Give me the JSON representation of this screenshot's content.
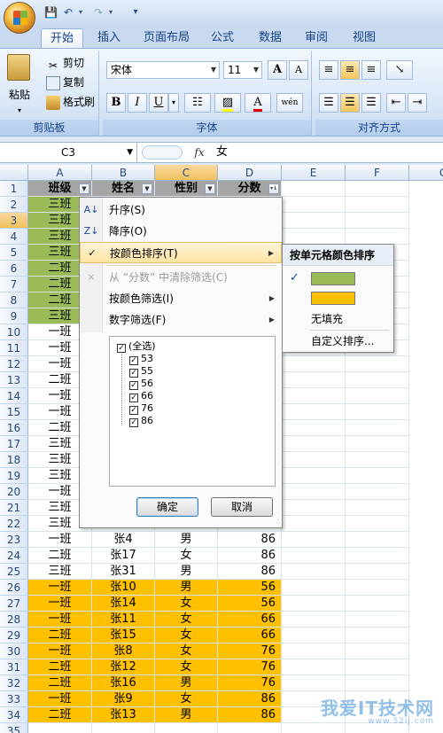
{
  "ribbon_tabs": [
    "开始",
    "插入",
    "页面布局",
    "公式",
    "数据",
    "审阅",
    "视图"
  ],
  "clipboard": {
    "paste": "粘贴",
    "cut": "剪切",
    "copy": "复制",
    "format_painter": "格式刷",
    "group": "剪贴板"
  },
  "font": {
    "name": "宋体",
    "size": "11",
    "group": "字体",
    "bold": "B",
    "italic": "I",
    "underline": "U",
    "grow": "A",
    "shrink": "A",
    "wen": "wén"
  },
  "alignment": {
    "group": "对齐方式"
  },
  "formula_bar": {
    "name_box": "C3",
    "fx": "fx",
    "content": "女"
  },
  "columns": [
    "A",
    "B",
    "C",
    "D",
    "E",
    "F",
    "G"
  ],
  "headers": {
    "a": "班级",
    "b": "姓名",
    "c": "性别",
    "d": "分数"
  },
  "rows": [
    {
      "n": "1"
    },
    {
      "n": "2",
      "a": "三班"
    },
    {
      "n": "3",
      "a": "三班"
    },
    {
      "n": "4",
      "a": "三班"
    },
    {
      "n": "5",
      "a": "三班"
    },
    {
      "n": "6",
      "a": "二班"
    },
    {
      "n": "7",
      "a": "二班"
    },
    {
      "n": "8",
      "a": "二班"
    },
    {
      "n": "9",
      "a": "三班"
    },
    {
      "n": "10",
      "a": "一班"
    },
    {
      "n": "11",
      "a": "一班"
    },
    {
      "n": "12",
      "a": "一班"
    },
    {
      "n": "13",
      "a": "二班"
    },
    {
      "n": "14",
      "a": "一班"
    },
    {
      "n": "15",
      "a": "一班"
    },
    {
      "n": "16",
      "a": "二班"
    },
    {
      "n": "17",
      "a": "三班"
    },
    {
      "n": "18",
      "a": "三班"
    },
    {
      "n": "19",
      "a": "三班"
    },
    {
      "n": "20",
      "a": "一班"
    },
    {
      "n": "21",
      "a": "三班"
    },
    {
      "n": "22",
      "a": "三班"
    },
    {
      "n": "23",
      "a": "一班",
      "b": "张4",
      "c": "男",
      "d": "86"
    },
    {
      "n": "24",
      "a": "二班",
      "b": "张17",
      "c": "女",
      "d": "86"
    },
    {
      "n": "25",
      "a": "三班",
      "b": "张31",
      "c": "男",
      "d": "86"
    },
    {
      "n": "26",
      "a": "一班",
      "b": "张10",
      "c": "男",
      "d": "56"
    },
    {
      "n": "27",
      "a": "一班",
      "b": "张14",
      "c": "女",
      "d": "56"
    },
    {
      "n": "28",
      "a": "一班",
      "b": "张11",
      "c": "女",
      "d": "66"
    },
    {
      "n": "29",
      "a": "二班",
      "b": "张15",
      "c": "女",
      "d": "66"
    },
    {
      "n": "30",
      "a": "一班",
      "b": "张8",
      "c": "女",
      "d": "76"
    },
    {
      "n": "31",
      "a": "二班",
      "b": "张12",
      "c": "女",
      "d": "76"
    },
    {
      "n": "32",
      "a": "二班",
      "b": "张16",
      "c": "男",
      "d": "76"
    },
    {
      "n": "33",
      "a": "一班",
      "b": "张9",
      "c": "女",
      "d": "86"
    },
    {
      "n": "34",
      "a": "二班",
      "b": "张13",
      "c": "男",
      "d": "86"
    },
    {
      "n": "35"
    }
  ],
  "colors": {
    "green_fill": "#9bbb59",
    "orange_fill": "#ffc000",
    "header_gray": "#a5a5a5"
  },
  "filter_menu": {
    "sort_asc": "升序(S)",
    "sort_desc": "降序(O)",
    "sort_by_color": "按颜色排序(T)",
    "clear_filter": "从 “分数” 中清除筛选(C)",
    "filter_by_color": "按颜色筛选(I)",
    "number_filter": "数字筛选(F)",
    "checklist": [
      "(全选)",
      "53",
      "55",
      "56",
      "66",
      "76",
      "86"
    ],
    "ok": "确定",
    "cancel": "取消"
  },
  "sort_color_submenu": {
    "title": "按单元格颜色排序",
    "no_fill": "无填充",
    "custom": "自定义排序..."
  },
  "watermark": {
    "text": "我爱IT技术网",
    "url": "www.52ij.com"
  }
}
